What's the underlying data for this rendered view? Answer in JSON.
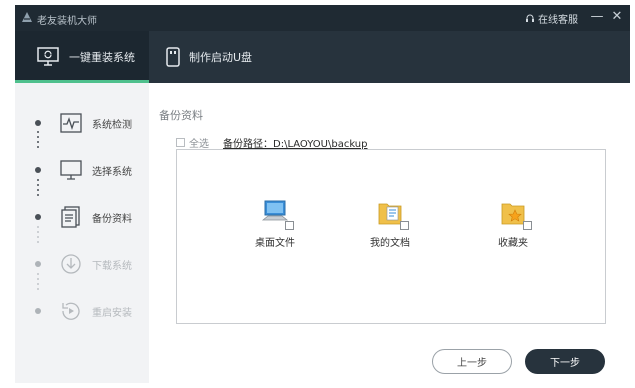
{
  "window": {
    "title": "老友装机大师",
    "feedback_label": "在线客服",
    "minimize_glyph": "—",
    "close_glyph": "✕"
  },
  "tabs": [
    {
      "label": "一键重装系统",
      "icon": "monitor-refresh-icon",
      "active": true
    },
    {
      "label": "制作启动U盘",
      "icon": "usb-drive-icon",
      "active": false
    }
  ],
  "steps": [
    {
      "label": "系统检测",
      "icon": "pulse-icon",
      "state": "done"
    },
    {
      "label": "选择系统",
      "icon": "monitor-icon",
      "state": "done"
    },
    {
      "label": "备份资料",
      "icon": "document-icon",
      "state": "current"
    },
    {
      "label": "下载系统",
      "icon": "download-icon",
      "state": "pending"
    },
    {
      "label": "重启安装",
      "icon": "restart-icon",
      "state": "pending"
    }
  ],
  "main": {
    "section_title": "备份资料",
    "select_all_label": "全选",
    "backup_path": "备份路径：D:\\LAOYOU\\backup",
    "items": [
      {
        "label": "桌面文件",
        "icon": "computer-icon",
        "checked": false
      },
      {
        "label": "我的文档",
        "icon": "documents-folder-icon",
        "checked": false
      },
      {
        "label": "收藏夹",
        "icon": "favorites-folder-icon",
        "checked": false
      }
    ],
    "prev_label": "上一步",
    "next_label": "下一步"
  },
  "colors": {
    "titlebar_bg": "#1f2a33",
    "tabbar_bg": "#27333d",
    "active_tab_bg": "#1c2730",
    "active_accent": "#4fc08d",
    "sidebar_bg": "#f2f3f5",
    "next_button_bg": "#27333d"
  }
}
